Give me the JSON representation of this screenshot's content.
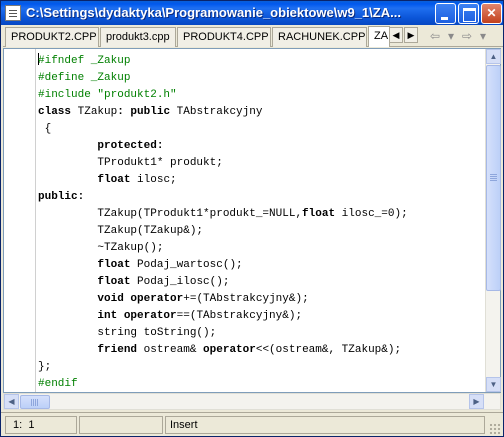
{
  "window": {
    "title": "C:\\Settings\\dydaktyka\\Programowanie_obiektowe\\w9_1\\ZA...",
    "minimize_icon": "minimize-icon",
    "maximize_icon": "maximize-icon",
    "close_label": "✕"
  },
  "tabs": [
    {
      "label": "PRODUKT2.CPP"
    },
    {
      "label": "produkt3.cpp"
    },
    {
      "label": "PRODUKT4.CPP"
    },
    {
      "label": "RACHUNEK.CPP"
    },
    {
      "label": "ZA"
    }
  ],
  "tab_nav": {
    "prev": "◀",
    "next": "▶",
    "back": "⇦",
    "forward": "⇨",
    "dropdown": "▾"
  },
  "editor": {
    "lines": [
      [
        {
          "t": "#ifndef _Zakup",
          "s": "pp"
        }
      ],
      [
        {
          "t": "#define _Zakup",
          "s": "pp"
        }
      ],
      [
        {
          "t": "#include \"produkt2.h\"",
          "s": "pp"
        }
      ],
      [
        {
          "t": "class",
          "s": "kw"
        },
        {
          "t": " TZakup",
          "s": ""
        },
        {
          "t": ": public",
          "s": "kw"
        },
        {
          "t": " TAbstrakcyjny",
          "s": ""
        }
      ],
      [
        {
          "t": " {",
          "s": ""
        }
      ],
      [
        {
          "t": "         ",
          "s": ""
        },
        {
          "t": "protected:",
          "s": "kw"
        }
      ],
      [
        {
          "t": "         TProdukt1* produkt;",
          "s": ""
        }
      ],
      [
        {
          "t": "         ",
          "s": ""
        },
        {
          "t": "float",
          "s": "kw"
        },
        {
          "t": " ilosc;",
          "s": ""
        }
      ],
      [
        {
          "t": "public:",
          "s": "kw"
        }
      ],
      [
        {
          "t": "         TZakup(TProdukt1*produkt_=NULL,",
          "s": ""
        },
        {
          "t": "float",
          "s": "kw"
        },
        {
          "t": " ilosc_=0);",
          "s": ""
        }
      ],
      [
        {
          "t": "         TZakup(TZakup&);",
          "s": ""
        }
      ],
      [
        {
          "t": "         ~TZakup();",
          "s": ""
        }
      ],
      [
        {
          "t": "         ",
          "s": ""
        },
        {
          "t": "float",
          "s": "kw"
        },
        {
          "t": " Podaj_wartosc();",
          "s": ""
        }
      ],
      [
        {
          "t": "         ",
          "s": ""
        },
        {
          "t": "float",
          "s": "kw"
        },
        {
          "t": " Podaj_ilosc();",
          "s": ""
        }
      ],
      [
        {
          "t": "         ",
          "s": ""
        },
        {
          "t": "void operator",
          "s": "kw"
        },
        {
          "t": "+=(TAbstrakcyjny&);",
          "s": ""
        }
      ],
      [
        {
          "t": "         ",
          "s": ""
        },
        {
          "t": "int operator",
          "s": "kw"
        },
        {
          "t": "==(TAbstrakcyjny&);",
          "s": ""
        }
      ],
      [
        {
          "t": "         string toString();",
          "s": ""
        }
      ],
      [
        {
          "t": "         ",
          "s": ""
        },
        {
          "t": "friend",
          "s": "kw"
        },
        {
          "t": " ostream& ",
          "s": ""
        },
        {
          "t": "operator",
          "s": "kw"
        },
        {
          "t": "<<(ostream&, TZakup&);",
          "s": ""
        }
      ],
      [
        {
          "t": "};",
          "s": ""
        }
      ],
      [
        {
          "t": "#endif",
          "s": "pp"
        }
      ]
    ]
  },
  "status": {
    "position": " 1:  1",
    "mode": "Insert",
    "empty": ""
  },
  "colors": {
    "preprocessor": "#008000",
    "titlebar": "#0058ee"
  }
}
